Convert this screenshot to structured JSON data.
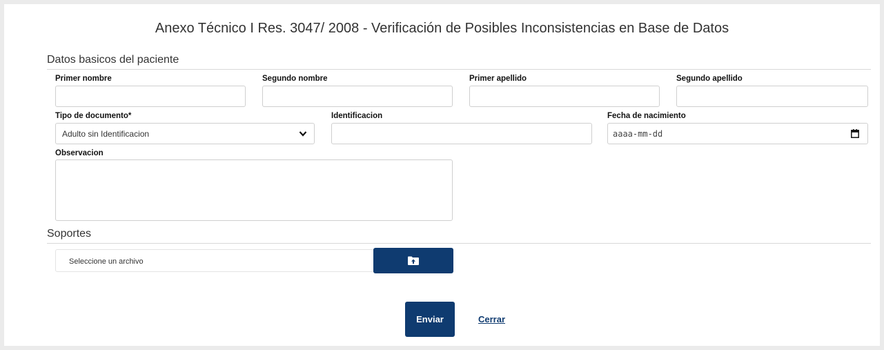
{
  "form": {
    "title": "Anexo Técnico I Res. 3047/ 2008 - Verificación de Posibles Inconsistencias en Base de Datos",
    "section_patient": "Datos basicos del paciente",
    "section_supports": "Soportes",
    "labels": {
      "primer_nombre": "Primer nombre",
      "segundo_nombre": "Segundo nombre",
      "primer_apellido": "Primer apellido",
      "segundo_apellido": "Segundo apellido",
      "tipo_documento": "Tipo de documento*",
      "identificacion": "Identificacion",
      "fecha_nacimiento": "Fecha de nacimiento",
      "observacion": "Observacion"
    },
    "values": {
      "tipo_documento": "Adulto sin Identificacion",
      "fecha_nacimiento_placeholder": "aaaa-mm-dd"
    },
    "file": {
      "placeholder": "Seleccione un archivo",
      "button_icon": "folder-upload-icon"
    },
    "actions": {
      "send": "Enviar",
      "close": "Cerrar"
    },
    "colors": {
      "primary": "#0f3b70",
      "background": "#ebebeb"
    }
  }
}
